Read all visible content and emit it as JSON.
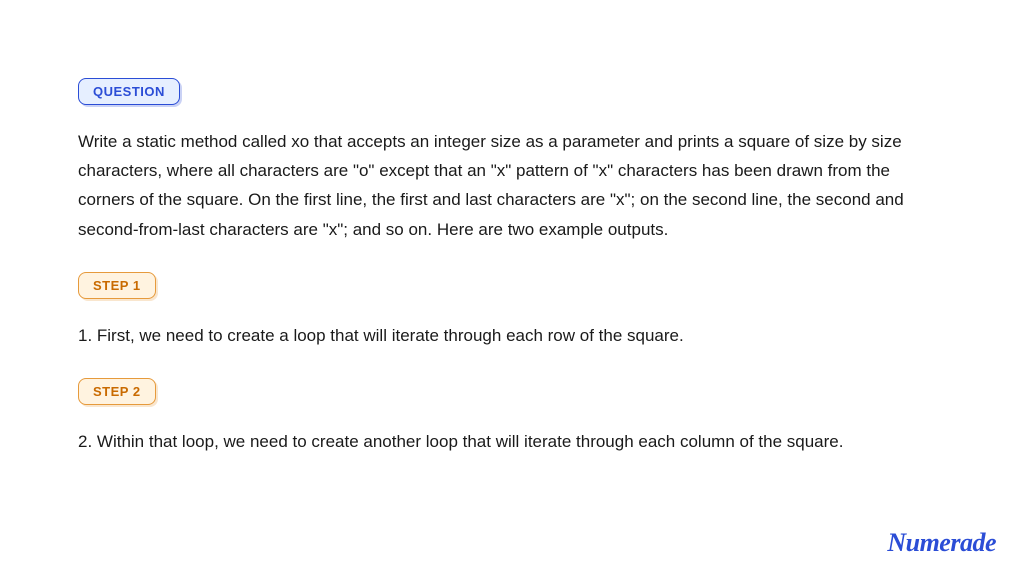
{
  "question": {
    "badge_label": "QUESTION",
    "text": "Write a static method called xo that accepts an integer size as a parameter and prints a square of size by size characters, where all characters are \"o\" except that an \"x\" pattern of \"x\" characters has been drawn from the corners of the square. On the first line, the first and last characters are \"x\"; on the second line, the second and second-from-last characters are \"x\"; and so on. Here are two example outputs."
  },
  "steps": [
    {
      "badge_label": "STEP 1",
      "text": "1. First, we need to create a loop that will iterate through each row of the square."
    },
    {
      "badge_label": "STEP 2",
      "text": "2. Within that loop, we need to create another loop that will iterate through each column of the square."
    }
  ],
  "logo_text": "Numerade"
}
